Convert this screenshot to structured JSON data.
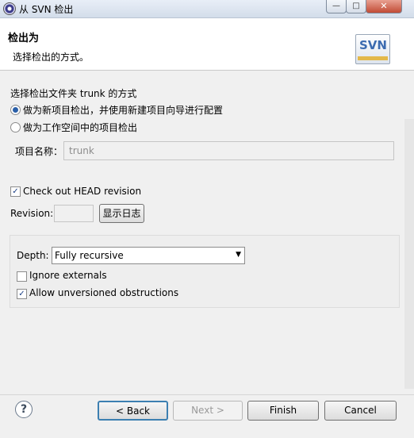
{
  "window": {
    "title": "从 SVN 检出",
    "controls": {
      "minimize": "—",
      "maximize": "□",
      "close": "✕"
    }
  },
  "header": {
    "title": "检出为",
    "description": "选择检出的方式。",
    "logo_text": "SVN"
  },
  "checkout": {
    "section_label": "选择检出文件夹 trunk 的方式",
    "options": [
      {
        "label": "做为新项目检出，并使用新建项目向导进行配置",
        "selected": true
      },
      {
        "label": "做为工作空间中的项目检出",
        "selected": false
      }
    ],
    "project_name_label": "项目名称：",
    "project_name_value": "trunk"
  },
  "revision": {
    "head_checkbox_label": "Check out HEAD revision",
    "head_checked": true,
    "revision_label": "Revision:",
    "revision_value": "",
    "show_log_button": "显示日志"
  },
  "depth": {
    "label": "Depth:",
    "selected": "Fully recursive",
    "ignore_externals_label": "Ignore externals",
    "ignore_externals_checked": false,
    "allow_unversioned_label": "Allow unversioned obstructions",
    "allow_unversioned_checked": true
  },
  "footer": {
    "help_icon": "?",
    "back": "< Back",
    "next": "Next >",
    "finish": "Finish",
    "cancel": "Cancel"
  }
}
